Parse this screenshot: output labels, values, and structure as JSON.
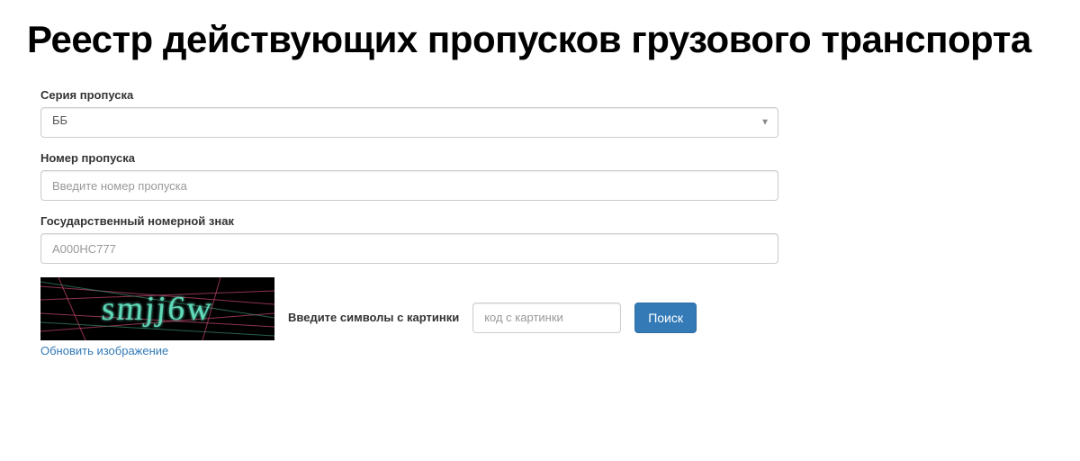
{
  "page": {
    "title": "Реестр действующих пропусков грузового транспорта"
  },
  "form": {
    "series": {
      "label": "Серия пропуска",
      "value": "ББ"
    },
    "number": {
      "label": "Номер пропуска",
      "placeholder": "Введите номер пропуска"
    },
    "plate": {
      "label": "Государственный номерной знак",
      "placeholder": "А000НС777"
    },
    "captcha": {
      "image_text": "smjj6w",
      "refresh_label": "Обновить изображение",
      "input_label": "Введите символы с картинки",
      "input_placeholder": "код с картинки"
    },
    "search_button": "Поиск"
  }
}
